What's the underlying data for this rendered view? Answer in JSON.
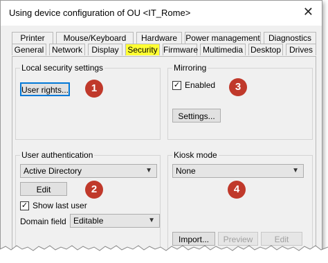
{
  "window": {
    "title": "Using device configuration of OU <IT_Rome>",
    "close_icon": "close-icon"
  },
  "tabs_top": [
    "Printer",
    "Mouse/Keyboard",
    "Hardware",
    "Power management",
    "Diagnostics"
  ],
  "tabs_bottom": [
    "General",
    "Network",
    "Display",
    "Security",
    "Firmware",
    "Multimedia",
    "Desktop",
    "Drives"
  ],
  "active_tab": "Security",
  "local_security": {
    "label": "Local security settings",
    "user_rights_button": "User rights..."
  },
  "mirroring": {
    "label": "Mirroring",
    "enabled_label": "Enabled",
    "enabled_checked": true,
    "settings_button": "Settings..."
  },
  "user_auth": {
    "label": "User authentication",
    "method": "Active Directory",
    "edit_button": "Edit",
    "show_last_user_label": "Show last user",
    "show_last_user_checked": true,
    "domain_field_label": "Domain field",
    "domain_field_value": "Editable"
  },
  "kiosk": {
    "label": "Kiosk mode",
    "mode": "None",
    "import_button": "Import...",
    "preview_button": "Preview",
    "edit_button": "Edit"
  },
  "badges": [
    "1",
    "2",
    "3",
    "4"
  ],
  "colors": {
    "active_tab": "#ffff33",
    "badge": "#c0392b",
    "focus": "#0078d7"
  }
}
